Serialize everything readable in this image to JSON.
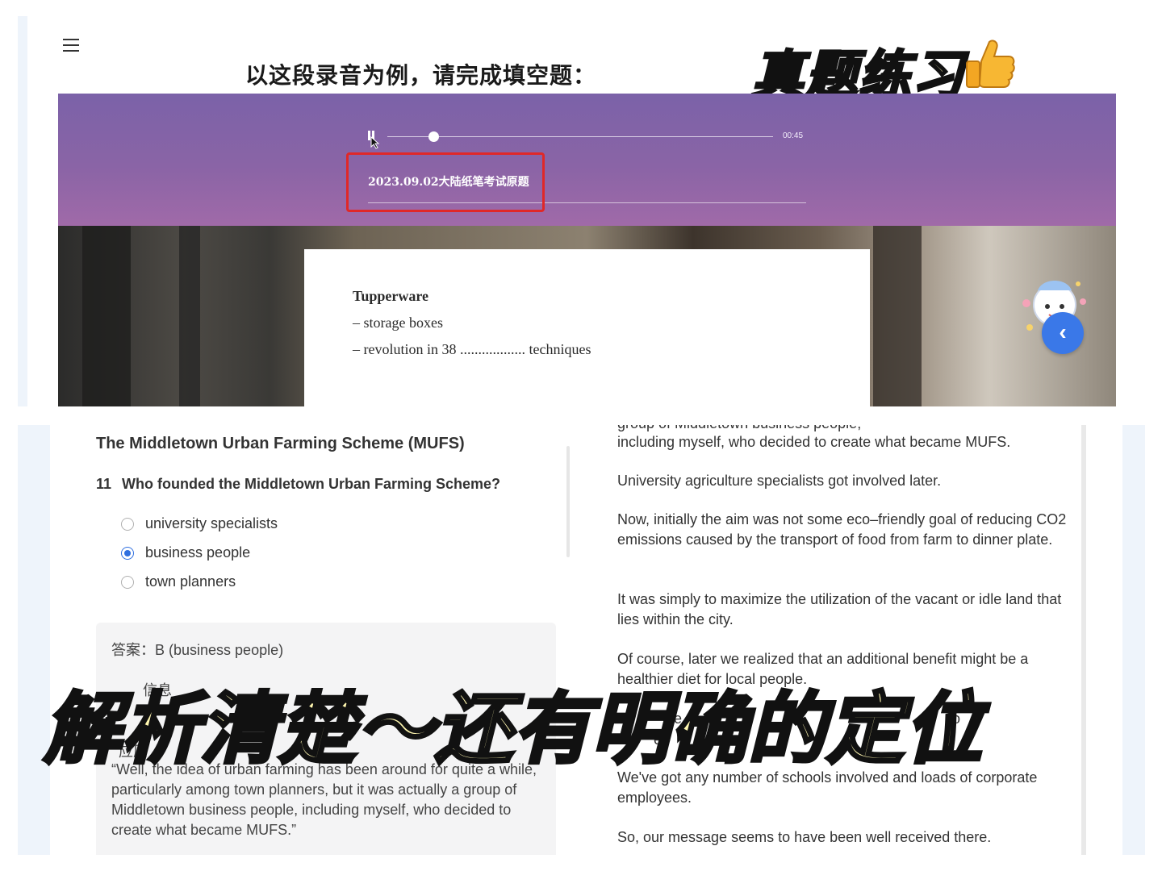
{
  "header": {
    "heading": "以这段录音为例，请完成填空题：",
    "promo_tag": "真题练习"
  },
  "audio": {
    "time": "00:45",
    "title": "2023.09.02大陆纸笔考试原题",
    "progress": 0.12
  },
  "slide": {
    "lines": [
      "Tupperware",
      "– storage boxes",
      "– revolution in 38 .................. techniques"
    ]
  },
  "passage": {
    "title": "The Middletown Urban Farming Scheme (MUFS)",
    "question_number": "11",
    "question_text": "Who founded the Middletown Urban Farming Scheme?",
    "options": [
      "university specialists",
      "business people",
      "town planners"
    ],
    "selected_option": "business people"
  },
  "answer": {
    "answer_line": "答案：B (business people)",
    "partial_labels": [
      "信息",
      "de",
      "应原"
    ],
    "quote": "“Well, the idea of urban farming has been around for quite a while, particularly among town planners, but it was actually a group of Middletown business people, including myself, who decided to create what became MUFS.”"
  },
  "transcript": {
    "cut_line": "group of Middletown business people,",
    "paragraphs": [
      "including myself, who decided to create what became MUFS.",
      "University agriculture specialists got involved later.",
      "Now, initially the aim was not some eco–friendly goal of reducing CO2 emissions caused by the transport of food from farm to dinner plate.",
      "It was simply to maximize the utilization of the vacant or idle land that lies within the city.",
      "Of course, later we realized that an additional benefit might be a healthier diet for local people.",
      "We've got any number of schools involved and loads of corporate employees.",
      "So, our message seems to have been well received there."
    ],
    "partial_fragments": [
      "te",
      "jo",
      "e."
    ]
  },
  "overlay": {
    "caption": "解析清楚～还有明确的定位"
  },
  "colors": {
    "accent": "#3a78e8",
    "highlight_border": "#e02828",
    "banner": "#7b62a8",
    "caption_fill": "#fff7b0"
  },
  "icons": [
    "menu-icon",
    "thumbs-up-icon",
    "pause-icon",
    "cursor-icon",
    "mascot-icon",
    "chevron-left-icon"
  ]
}
